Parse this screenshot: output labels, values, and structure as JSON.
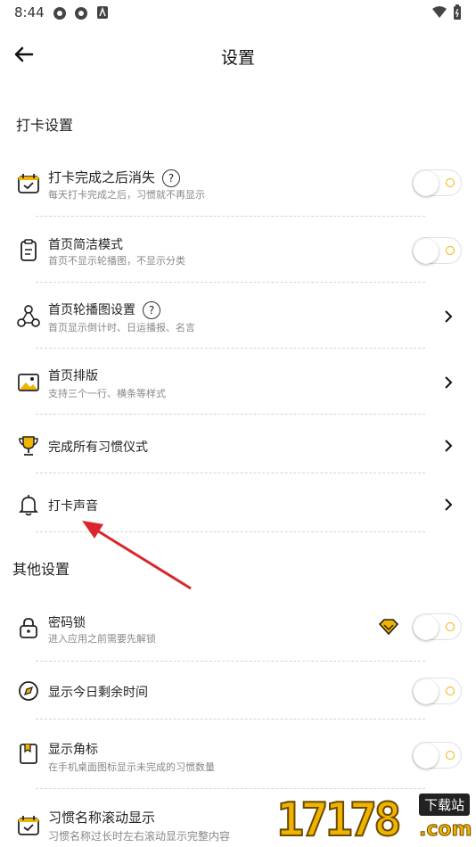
{
  "status": {
    "time": "8:44"
  },
  "header": {
    "title": "设置"
  },
  "sections": {
    "checkin": "打卡设置",
    "other": "其他设置"
  },
  "rows": {
    "disappear": {
      "title": "打卡完成之后消失",
      "sub": "每天打卡完成之后，习惯就不再显示"
    },
    "simple": {
      "title": "首页简洁模式",
      "sub": "首页不显示轮播图，不显示分类"
    },
    "carousel": {
      "title": "首页轮播图设置",
      "sub": "首页显示倒计时、日运播报、名言"
    },
    "layout": {
      "title": "首页排版",
      "sub": "支持三个一行、横条等样式"
    },
    "ritual": {
      "title": "完成所有习惯仪式"
    },
    "sound": {
      "title": "打卡声音"
    },
    "lock": {
      "title": "密码锁",
      "sub": "进入应用之前需要先解锁"
    },
    "remaining": {
      "title": "显示今日剩余时间"
    },
    "badge": {
      "title": "显示角标",
      "sub": "在手机桌面图标显示未完成的习惯数量"
    },
    "scroll": {
      "title": "习惯名称滚动显示",
      "sub": "习惯名称过长时左右滚动显示完整内容"
    }
  },
  "help_glyph": "?",
  "watermark": {
    "number": "17178",
    "tag": "下载站",
    "domain": ".com"
  },
  "colors": {
    "accent": "#f0b400",
    "arrow": "#d9262b"
  }
}
